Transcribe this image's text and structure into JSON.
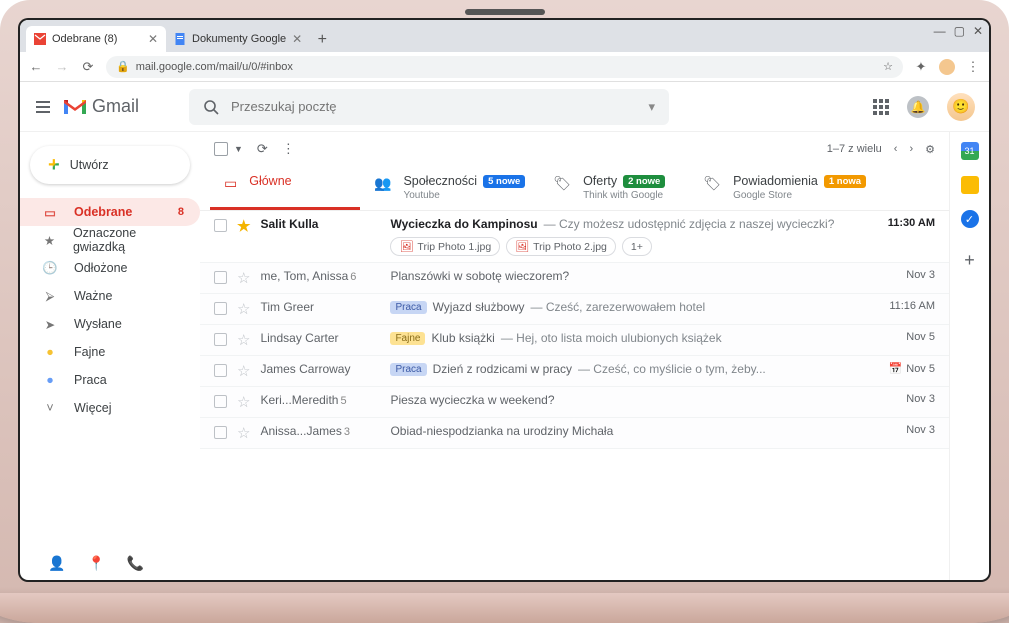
{
  "browser": {
    "tabs": [
      {
        "title": "Odebrane (8)",
        "icon": "gmail"
      },
      {
        "title": "Dokumenty Google",
        "icon": "docs"
      }
    ],
    "url": "mail.google.com/mail/u/0/#inbox"
  },
  "header": {
    "product": "Gmail",
    "search_placeholder": "Przeszukaj pocztę"
  },
  "compose_label": "Utwórz",
  "sidebar": [
    {
      "icon": "inbox",
      "label": "Odebrane",
      "count": "8",
      "active": true
    },
    {
      "icon": "star",
      "label": "Oznaczone gwiazdką"
    },
    {
      "icon": "clock",
      "label": "Odłożone"
    },
    {
      "icon": "important",
      "label": "Ważne"
    },
    {
      "icon": "sent",
      "label": "Wysłane"
    },
    {
      "icon": "label",
      "label": "Fajne",
      "color": "#f4b400"
    },
    {
      "icon": "label",
      "label": "Praca",
      "color": "#4285f4"
    },
    {
      "icon": "more",
      "label": "Więcej"
    }
  ],
  "toolbar": {
    "range": "1–7 z wielu"
  },
  "category_tabs": [
    {
      "icon": "inbox",
      "title": "Główne",
      "active": true
    },
    {
      "icon": "people",
      "title": "Społeczności",
      "badge": "5 nowe",
      "badge_style": "blue",
      "sub": "Youtube"
    },
    {
      "icon": "tag",
      "title": "Oferty",
      "badge": "2 nowe",
      "badge_style": "green",
      "sub": "Think with Google"
    },
    {
      "icon": "tag",
      "title": "Powiadomienia",
      "badge": "1 nowa",
      "badge_style": "orange",
      "sub": "Google Store"
    }
  ],
  "emails": [
    {
      "unread": true,
      "starred": true,
      "sender": "Salit Kulla",
      "subject": "Wycieczka do Kampinosu",
      "snippet": "Czy możesz udostępnić zdjęcia z naszej wycieczki?",
      "date": "11:30 AM",
      "attachments": [
        "Trip Photo 1.jpg",
        "Trip Photo 2.jpg"
      ],
      "attach_more": "1+"
    },
    {
      "unread": false,
      "sender": "me, Tom, Anissa",
      "sender_count": "6",
      "subject": "Planszówki w sobotę wieczorem?",
      "date": "Nov 3"
    },
    {
      "unread": false,
      "sender": "Tim Greer",
      "label": "Praca",
      "label_style": "lbl-blue",
      "subject": "Wyjazd służbowy",
      "snippet": "Cześć, zarezerwowałem hotel",
      "date": "11:16 AM"
    },
    {
      "unread": false,
      "sender": "Lindsay Carter",
      "label": "Fajne",
      "label_style": "lbl-yellow",
      "subject": "Klub książki",
      "snippet": "Hej, oto lista moich ulubionych książek",
      "date": "Nov 5"
    },
    {
      "unread": false,
      "sender": "James Carroway",
      "label": "Praca",
      "label_style": "lbl-blue",
      "subject": "Dzień z rodzicami w pracy",
      "snippet": "Cześć, co myślicie o tym, żeby...",
      "date": "Nov 5",
      "event_icon": true
    },
    {
      "unread": false,
      "sender": "Keri...Meredith",
      "sender_count": "5",
      "subject": "Piesza wycieczka w weekend?",
      "date": "Nov 3"
    },
    {
      "unread": false,
      "sender": "Anissa...James",
      "sender_count": "3",
      "subject": "Obiad-niespodzianka na urodziny Michała",
      "date": "Nov 3"
    }
  ]
}
